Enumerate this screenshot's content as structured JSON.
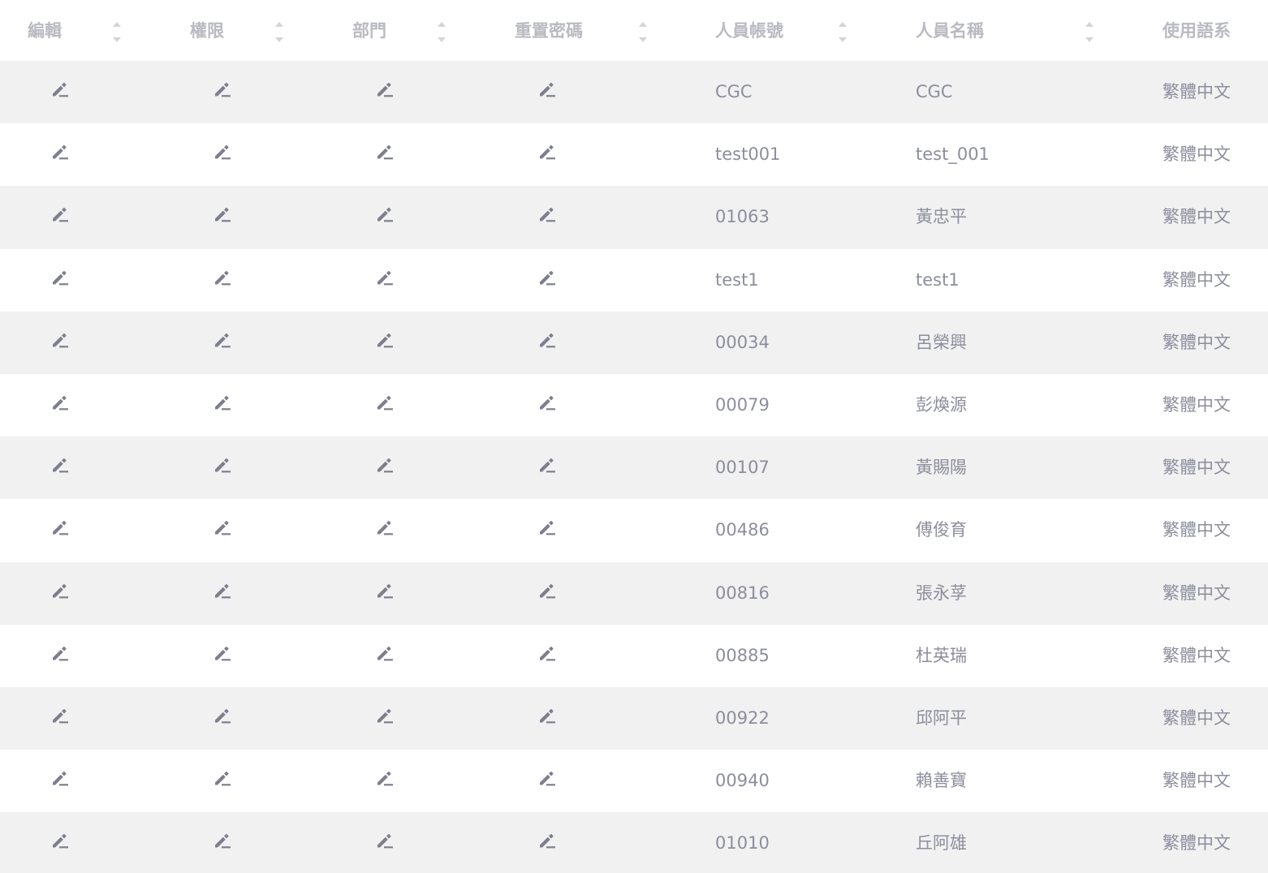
{
  "table": {
    "columns": [
      {
        "label": "編輯",
        "sortable": true
      },
      {
        "label": "權限",
        "sortable": true
      },
      {
        "label": "部門",
        "sortable": true
      },
      {
        "label": "重置密碼",
        "sortable": true
      },
      {
        "label": "人員帳號",
        "sortable": true
      },
      {
        "label": "人員名稱",
        "sortable": true
      },
      {
        "label": "使用語系",
        "sortable": false
      }
    ],
    "row_action_icon": "edit-pencil-icon",
    "rows": [
      {
        "account": "CGC",
        "name": "CGC",
        "language": "繁體中文"
      },
      {
        "account": "test001",
        "name": "test_001",
        "language": "繁體中文"
      },
      {
        "account": "01063",
        "name": "黃忠平",
        "language": "繁體中文"
      },
      {
        "account": "test1",
        "name": "test1",
        "language": "繁體中文"
      },
      {
        "account": "00034",
        "name": "呂榮興",
        "language": "繁體中文"
      },
      {
        "account": "00079",
        "name": "彭煥源",
        "language": "繁體中文"
      },
      {
        "account": "00107",
        "name": "黃賜陽",
        "language": "繁體中文"
      },
      {
        "account": "00486",
        "name": "傅俊育",
        "language": "繁體中文"
      },
      {
        "account": "00816",
        "name": "張永莩",
        "language": "繁體中文"
      },
      {
        "account": "00885",
        "name": "杜英瑞",
        "language": "繁體中文"
      },
      {
        "account": "00922",
        "name": "邱阿平",
        "language": "繁體中文"
      },
      {
        "account": "00940",
        "name": "賴善寶",
        "language": "繁體中文"
      },
      {
        "account": "01010",
        "name": "丘阿雄",
        "language": "繁體中文"
      }
    ]
  },
  "colors": {
    "header_text": "#b9bac2",
    "body_text": "#8c8e9c",
    "icon": "#7d7f8f",
    "stripe": "#f1f1f2"
  }
}
